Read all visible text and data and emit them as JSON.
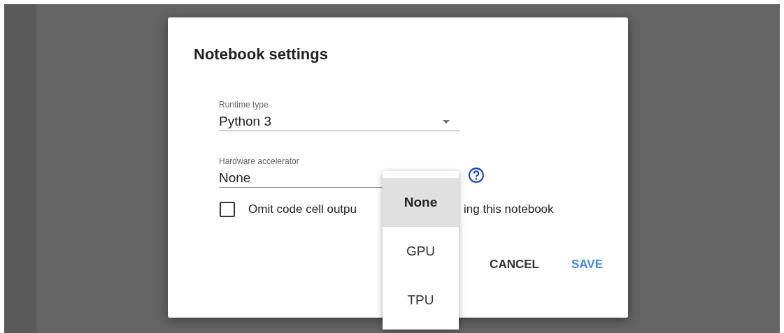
{
  "dialog": {
    "title": "Notebook settings",
    "runtime_type": {
      "label": "Runtime type",
      "value": "Python 3"
    },
    "hardware_accelerator": {
      "label": "Hardware accelerator",
      "value": "None"
    },
    "omit_output": {
      "checked": false,
      "label_visible_parts": [
        "Omit code cell outpu",
        "ing this notebook"
      ]
    },
    "buttons": [
      {
        "label": "CANCEL",
        "kind": "plain"
      },
      {
        "label": "SAVE",
        "kind": "primary"
      }
    ]
  },
  "accelerator_menu": [
    {
      "label": "None",
      "selected": true
    },
    {
      "label": "GPU",
      "selected": false
    },
    {
      "label": "TPU",
      "selected": false
    }
  ]
}
